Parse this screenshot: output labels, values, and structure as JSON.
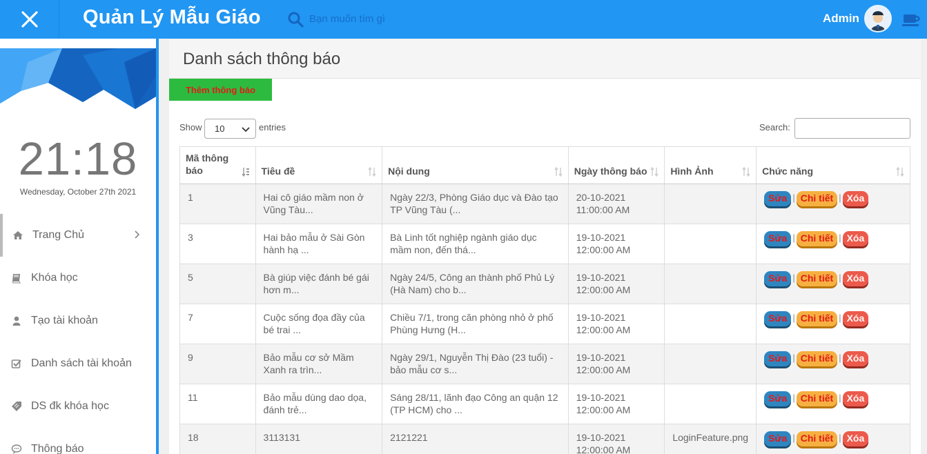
{
  "header": {
    "brand": "Quản Lý Mẫu Giáo",
    "search_placeholder": "Bạn muốn tìm gì",
    "user": "Admin",
    "accent": "#2196f3"
  },
  "sidebar": {
    "clock": "21:18",
    "date": "Wednesday, October 27th 2021",
    "items": [
      {
        "label": "Trang Chủ",
        "icon": "home-icon"
      },
      {
        "label": "Khóa học",
        "icon": "book-icon"
      },
      {
        "label": "Tạo tài khoản",
        "icon": "user-icon"
      },
      {
        "label": "Danh sách tài khoản",
        "icon": "check-square-icon"
      },
      {
        "label": "DS đk khóa học",
        "icon": "tag-icon"
      },
      {
        "label": "Thông báo",
        "icon": "comment-icon"
      }
    ]
  },
  "main": {
    "title": "Danh sách thông báo",
    "add_button": "Thêm thông báo",
    "show_label": "Show",
    "entries_value": "10",
    "entries_label": "entries",
    "search_label": "Search:",
    "columns": [
      "Mã thông báo",
      "Tiêu đề",
      "Nội dung",
      "Ngày thông báo",
      "Hình Ảnh",
      "Chức năng"
    ],
    "actions": {
      "edit": "Sửa",
      "detail": "Chi tiết",
      "delete": "Xóa",
      "separator": "|"
    },
    "rows": [
      {
        "id": "1",
        "title": "Hai cô giáo mầm non ở Vũng Tàu...",
        "content": "Ngày 22/3, Phòng Giáo dục và Đào tạo TP Vũng Tàu (...",
        "date": "20-10-2021",
        "time": "11:00:00 AM",
        "image": ""
      },
      {
        "id": "3",
        "title": "Hai bảo mẫu ở Sài Gòn hành hạ ...",
        "content": "Bà Linh tốt nghiệp ngành giáo dục mầm non, đến thá...",
        "date": "19-10-2021",
        "time": "12:00:00 AM",
        "image": ""
      },
      {
        "id": "5",
        "title": "Bà giúp việc đánh bé gái hơn m...",
        "content": "Ngày 24/5, Công an thành phố Phủ Lý (Hà Nam) cho b...",
        "date": "19-10-2021",
        "time": "12:00:00 AM",
        "image": ""
      },
      {
        "id": "7",
        "title": "Cuộc sống đọa đầy của bé trai ...",
        "content": "Chiều 7/1, trong căn phòng nhỏ ở phố Phùng Hưng (H...",
        "date": "19-10-2021",
        "time": "12:00:00 AM",
        "image": ""
      },
      {
        "id": "9",
        "title": "Bảo mẫu cơ sở Mầm Xanh ra trìn...",
        "content": "Ngày 29/1, Nguyễn Thị Đào (23 tuổi) - bảo mẫu cơ s...",
        "date": "19-10-2021",
        "time": "12:00:00 AM",
        "image": ""
      },
      {
        "id": "11",
        "title": "Bảo mẫu dùng dao dọa, đánh trẻ...",
        "content": "Sáng 28/11, lãnh đạo Công an quận 12 (TP HCM) cho ...",
        "date": "19-10-2021",
        "time": "12:00:00 AM",
        "image": ""
      },
      {
        "id": "18",
        "title": "3113131",
        "content": "2121221",
        "date": "19-10-2021",
        "time": "12:00:00 AM",
        "image": "LoginFeature.png"
      }
    ]
  }
}
